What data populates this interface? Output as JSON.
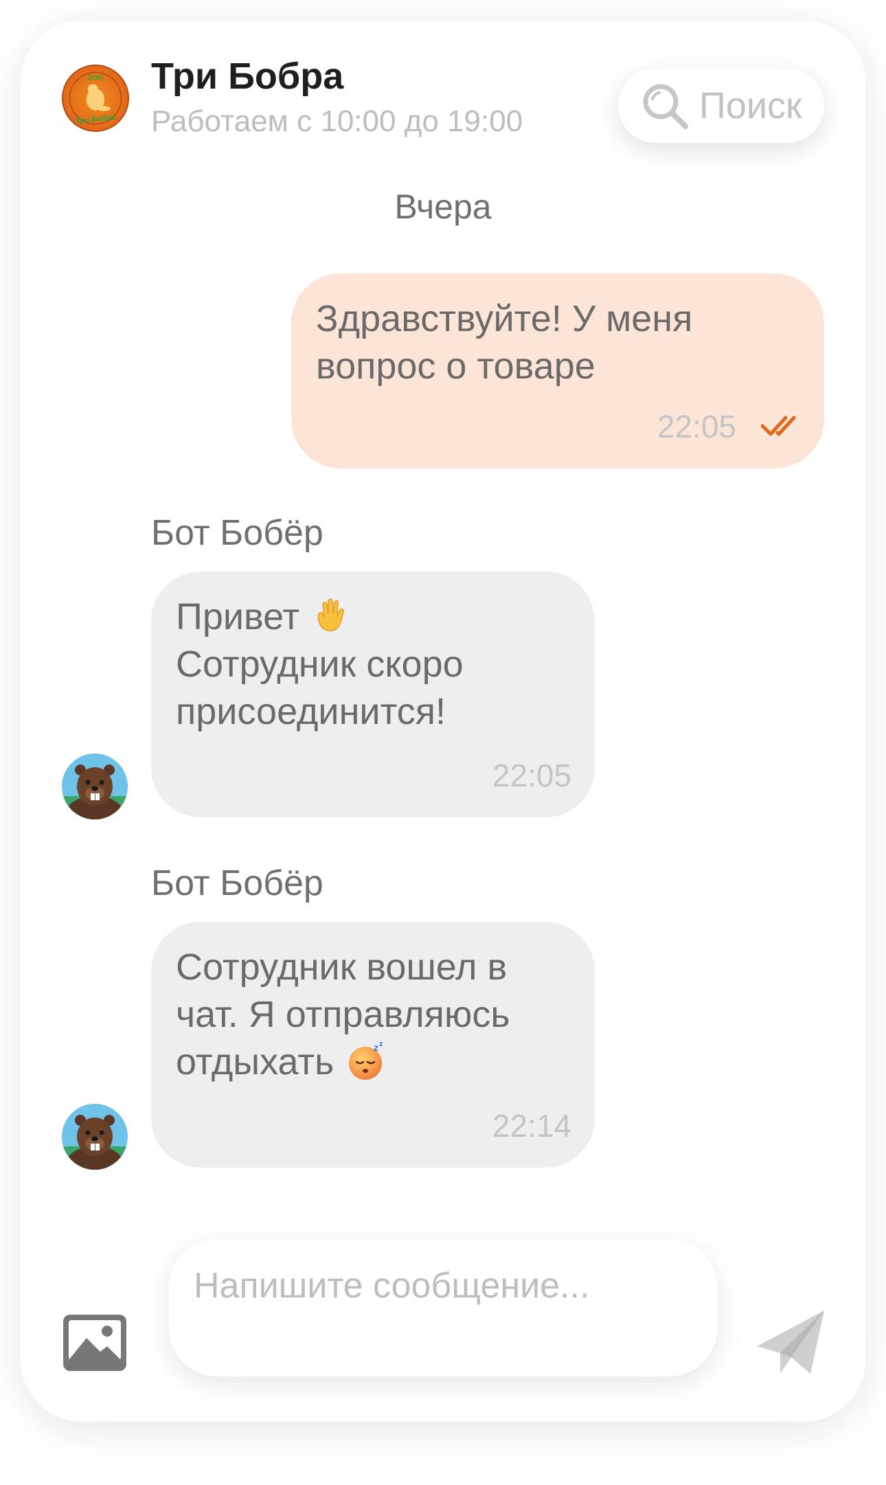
{
  "header": {
    "shop_name": "Три Бобра",
    "working_hours": "Работаем с 10:00 до 19:00",
    "logo_text": "ZOO Три Бобра",
    "search_placeholder": "Поиск"
  },
  "date_separator": "Вчера",
  "messages": [
    {
      "direction": "outgoing",
      "text": "Здравствуйте! У меня\nвопрос о товаре",
      "time": "22:05",
      "status_icon": "double-check-icon"
    },
    {
      "direction": "incoming",
      "sender": "Бот Бобёр",
      "text": "Привет",
      "text_rest": "Сотрудник скоро\nприсоединится!",
      "emoji": "waving-hand-emoji",
      "time": "22:05"
    },
    {
      "direction": "incoming",
      "sender": "Бот Бобёр",
      "text": "Сотрудник вошел в\nчат. Я отправляюсь\nотдыхать",
      "emoji": "sleeping-face-emoji",
      "time": "22:14"
    }
  ],
  "composer": {
    "placeholder": "Напишите сообщение...",
    "attach_icon": "image-icon",
    "send_icon": "send-icon"
  },
  "colors": {
    "outgoing_bubble": "#fce5d6",
    "incoming_bubble": "#eeeeee",
    "accent": "#e2681a"
  }
}
